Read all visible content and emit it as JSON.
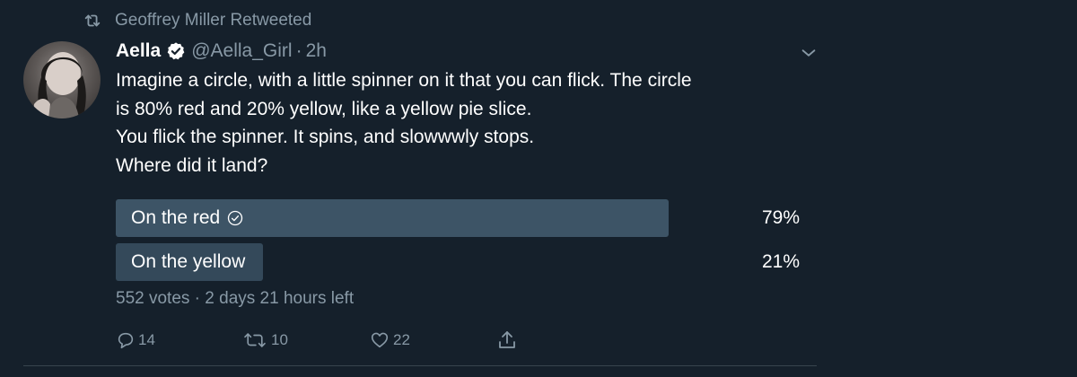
{
  "retweet": {
    "icon": "retweet-icon",
    "text": "Geoffrey Miller Retweeted"
  },
  "author": {
    "name": "Aella",
    "verified_icon": "verified-badge-icon",
    "handle": "@Aella_Girl",
    "separator": "·",
    "time": "2h"
  },
  "tweet": {
    "lines": [
      "Imagine a circle, with a little spinner on it that you can flick. The circle",
      "is 80% red and 20% yellow, like a yellow pie slice.",
      "You flick the spinner. It spins, and slowwwly stops.",
      "Where did it land?"
    ]
  },
  "poll": {
    "options": [
      {
        "label": "On the red",
        "percent": "79%",
        "value": 0.79,
        "winner": true
      },
      {
        "label": "On the yellow",
        "percent": "21%",
        "value": 0.21,
        "winner": false
      }
    ],
    "meta": "552 votes · 2 days 21 hours left"
  },
  "actions": {
    "reply_count": "14",
    "retweet_count": "10",
    "like_count": "22"
  },
  "colors": {
    "background": "#15202b",
    "secondary_text": "#8899a6",
    "poll_fill": "#3d5466",
    "verified": "#ffffff"
  }
}
